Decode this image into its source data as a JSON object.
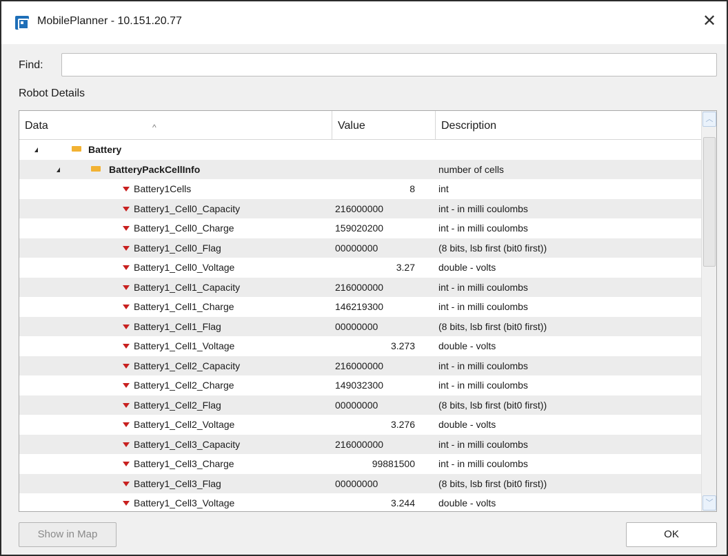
{
  "window": {
    "title": "MobilePlanner - 10.151.20.77",
    "close_glyph": "✕",
    "icon": "mobileplanner-app-icon"
  },
  "find": {
    "label": "Find:",
    "value": "",
    "placeholder": ""
  },
  "section": {
    "label": "Robot Details"
  },
  "table": {
    "columns": [
      "Data",
      "Value",
      "Description"
    ],
    "sort_glyph": "^",
    "rows": [
      {
        "level": 0,
        "kind": "group",
        "name": "Battery",
        "value": "",
        "align": "left",
        "desc": ""
      },
      {
        "level": 1,
        "kind": "group",
        "name": "BatteryPackCellInfo",
        "value": "",
        "align": "left",
        "desc": "number of cells"
      },
      {
        "level": 2,
        "kind": "leaf",
        "name": "Battery1Cells",
        "value": "8",
        "align": "right",
        "desc": "int"
      },
      {
        "level": 2,
        "kind": "leaf",
        "name": "Battery1_Cell0_Capacity",
        "value": "216000000",
        "align": "left",
        "desc": "int - in milli coulombs"
      },
      {
        "level": 2,
        "kind": "leaf",
        "name": "Battery1_Cell0_Charge",
        "value": "159020200",
        "align": "left",
        "desc": "int - in milli coulombs"
      },
      {
        "level": 2,
        "kind": "leaf",
        "name": "Battery1_Cell0_Flag",
        "value": "00000000",
        "align": "left",
        "desc": "(8 bits, lsb first (bit0 first))"
      },
      {
        "level": 2,
        "kind": "leaf",
        "name": "Battery1_Cell0_Voltage",
        "value": "3.27",
        "align": "right",
        "desc": "double - volts"
      },
      {
        "level": 2,
        "kind": "leaf",
        "name": "Battery1_Cell1_Capacity",
        "value": "216000000",
        "align": "left",
        "desc": "int - in milli coulombs"
      },
      {
        "level": 2,
        "kind": "leaf",
        "name": "Battery1_Cell1_Charge",
        "value": "146219300",
        "align": "left",
        "desc": "int - in milli coulombs"
      },
      {
        "level": 2,
        "kind": "leaf",
        "name": "Battery1_Cell1_Flag",
        "value": "00000000",
        "align": "left",
        "desc": "(8 bits, lsb first (bit0 first))"
      },
      {
        "level": 2,
        "kind": "leaf",
        "name": "Battery1_Cell1_Voltage",
        "value": "3.273",
        "align": "right",
        "desc": "double - volts"
      },
      {
        "level": 2,
        "kind": "leaf",
        "name": "Battery1_Cell2_Capacity",
        "value": "216000000",
        "align": "left",
        "desc": "int - in milli coulombs"
      },
      {
        "level": 2,
        "kind": "leaf",
        "name": "Battery1_Cell2_Charge",
        "value": "149032300",
        "align": "left",
        "desc": "int - in milli coulombs"
      },
      {
        "level": 2,
        "kind": "leaf",
        "name": "Battery1_Cell2_Flag",
        "value": "00000000",
        "align": "left",
        "desc": "(8 bits, lsb first (bit0 first))"
      },
      {
        "level": 2,
        "kind": "leaf",
        "name": "Battery1_Cell2_Voltage",
        "value": "3.276",
        "align": "right",
        "desc": "double - volts"
      },
      {
        "level": 2,
        "kind": "leaf",
        "name": "Battery1_Cell3_Capacity",
        "value": "216000000",
        "align": "left",
        "desc": "int - in milli coulombs"
      },
      {
        "level": 2,
        "kind": "leaf",
        "name": "Battery1_Cell3_Charge",
        "value": "99881500",
        "align": "right",
        "desc": "int - in milli coulombs"
      },
      {
        "level": 2,
        "kind": "leaf",
        "name": "Battery1_Cell3_Flag",
        "value": "00000000",
        "align": "left",
        "desc": "(8 bits, lsb first (bit0 first))"
      },
      {
        "level": 2,
        "kind": "leaf",
        "name": "Battery1_Cell3_Voltage",
        "value": "3.244",
        "align": "right",
        "desc": "double - volts"
      }
    ]
  },
  "buttons": {
    "show_in_map": "Show in Map",
    "ok": "OK"
  },
  "colors": {
    "folder": "#f2b233",
    "leaf_arrow": "#c8201f",
    "alt_row": "#ececec"
  }
}
